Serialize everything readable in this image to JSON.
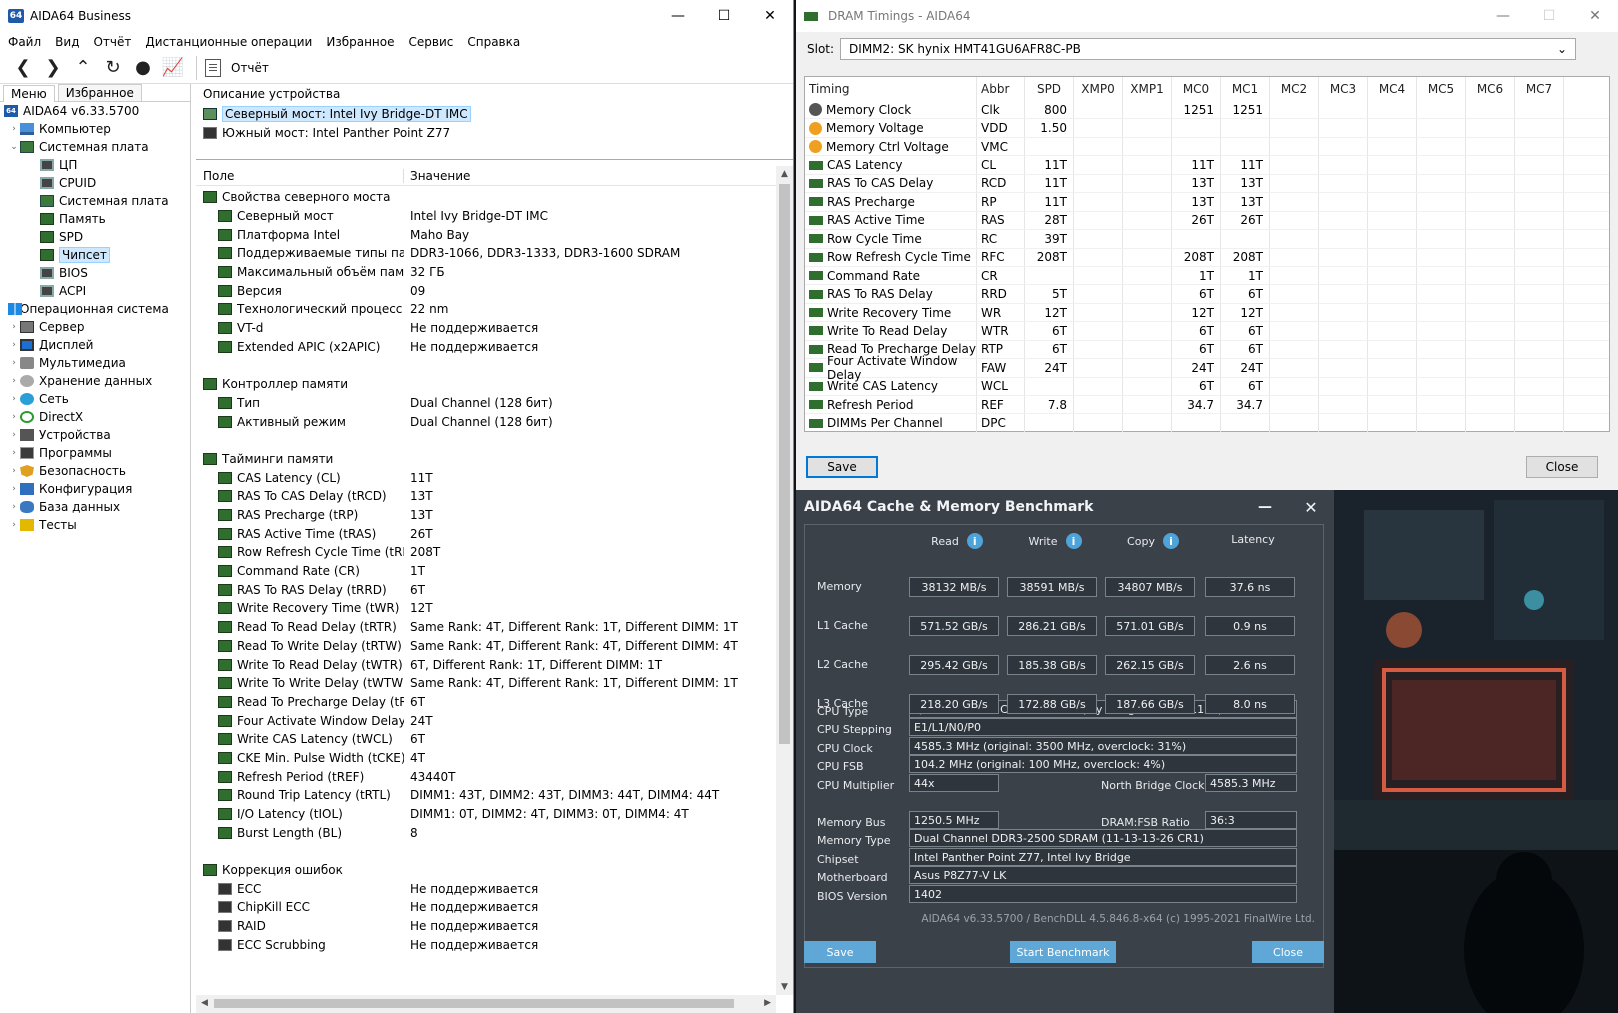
{
  "aida": {
    "title": "AIDA64 Business",
    "icon_text": "64",
    "menu": [
      "Файл",
      "Вид",
      "Отчёт",
      "Дистанционные операции",
      "Избранное",
      "Сервис",
      "Справка"
    ],
    "report_label": "Отчёт",
    "tabs": [
      "Меню",
      "Избранное"
    ],
    "tree": [
      {
        "label": "AIDA64 v6.33.5700",
        "icon": "aida-icon",
        "level": 0,
        "tw": ""
      },
      {
        "label": "Компьютер",
        "icon": "computer-icon",
        "level": 1,
        "tw": "›"
      },
      {
        "label": "Системная плата",
        "icon": "motherboard-icon",
        "level": 1,
        "tw": "⌄"
      },
      {
        "label": "ЦП",
        "icon": "cpu-icon",
        "level": 2,
        "tw": ""
      },
      {
        "label": "CPUID",
        "icon": "cpuid-icon",
        "level": 2,
        "tw": ""
      },
      {
        "label": "Системная плата",
        "icon": "board-icon",
        "level": 2,
        "tw": ""
      },
      {
        "label": "Память",
        "icon": "memory-icon",
        "level": 2,
        "tw": ""
      },
      {
        "label": "SPD",
        "icon": "spd-icon",
        "level": 2,
        "tw": ""
      },
      {
        "label": "Чипсет",
        "icon": "chipset-icon",
        "level": 2,
        "tw": "",
        "selected": true
      },
      {
        "label": "BIOS",
        "icon": "bios-icon",
        "level": 2,
        "tw": ""
      },
      {
        "label": "ACPI",
        "icon": "acpi-icon",
        "level": 2,
        "tw": ""
      },
      {
        "label": "Операционная система",
        "icon": "windows-icon",
        "level": 1,
        "tw": "›"
      },
      {
        "label": "Сервер",
        "icon": "server-icon",
        "level": 1,
        "tw": "›"
      },
      {
        "label": "Дисплей",
        "icon": "display-icon",
        "level": 1,
        "tw": "›"
      },
      {
        "label": "Мультимедиа",
        "icon": "multimedia-icon",
        "level": 1,
        "tw": "›"
      },
      {
        "label": "Хранение данных",
        "icon": "storage-icon",
        "level": 1,
        "tw": "›"
      },
      {
        "label": "Сеть",
        "icon": "network-icon",
        "level": 1,
        "tw": "›"
      },
      {
        "label": "DirectX",
        "icon": "directx-icon",
        "level": 1,
        "tw": "›"
      },
      {
        "label": "Устройства",
        "icon": "devices-icon",
        "level": 1,
        "tw": "›"
      },
      {
        "label": "Программы",
        "icon": "programs-icon",
        "level": 1,
        "tw": "›"
      },
      {
        "label": "Безопасность",
        "icon": "security-icon",
        "level": 1,
        "tw": "›"
      },
      {
        "label": "Конфигурация",
        "icon": "config-icon",
        "level": 1,
        "tw": "›"
      },
      {
        "label": "База данных",
        "icon": "database-icon",
        "level": 1,
        "tw": "›"
      },
      {
        "label": "Тесты",
        "icon": "tests-icon",
        "level": 1,
        "tw": "›"
      }
    ],
    "device_header": "Описание устройства",
    "devices": [
      "Северный мост: Intel Ivy Bridge-DT IMC",
      "Южный мост: Intel Panther Point Z77"
    ],
    "col_field": "Поле",
    "col_value": "Значение",
    "rows": [
      {
        "t": "g",
        "f": "Свойства северного моста",
        "v": ""
      },
      {
        "t": "s",
        "f": "Северный мост",
        "v": "Intel Ivy Bridge-DT IMC"
      },
      {
        "t": "s",
        "f": "Платформа Intel",
        "v": "Maho Bay"
      },
      {
        "t": "s",
        "f": "Поддерживаемые типы памя...",
        "v": "DDR3-1066, DDR3-1333, DDR3-1600 SDRAM"
      },
      {
        "t": "s",
        "f": "Максимальный объём памяти",
        "v": "32 ГБ"
      },
      {
        "t": "s",
        "f": "Версия",
        "v": "09"
      },
      {
        "t": "s",
        "f": "Технологический процесс",
        "v": "22 nm"
      },
      {
        "t": "s",
        "f": "VT-d",
        "v": "Не поддерживается"
      },
      {
        "t": "s",
        "f": "Extended APIC (x2APIC)",
        "v": "Не поддерживается"
      },
      {
        "t": "e",
        "f": "",
        "v": ""
      },
      {
        "t": "g",
        "f": "Контроллер памяти",
        "v": ""
      },
      {
        "t": "s",
        "f": "Тип",
        "v": "Dual Channel  (128 бит)"
      },
      {
        "t": "s",
        "f": "Активный режим",
        "v": "Dual Channel  (128 бит)"
      },
      {
        "t": "e",
        "f": "",
        "v": ""
      },
      {
        "t": "g",
        "f": "Тайминги памяти",
        "v": ""
      },
      {
        "t": "s",
        "f": "CAS Latency (CL)",
        "v": "11T"
      },
      {
        "t": "s",
        "f": "RAS To CAS Delay (tRCD)",
        "v": "13T"
      },
      {
        "t": "s",
        "f": "RAS Precharge (tRP)",
        "v": "13T"
      },
      {
        "t": "s",
        "f": "RAS Active Time (tRAS)",
        "v": "26T"
      },
      {
        "t": "s",
        "f": "Row Refresh Cycle Time (tRFC)",
        "v": "208T"
      },
      {
        "t": "s",
        "f": "Command Rate (CR)",
        "v": "1T"
      },
      {
        "t": "s",
        "f": "RAS To RAS Delay (tRRD)",
        "v": "6T"
      },
      {
        "t": "s",
        "f": "Write Recovery Time (tWR)",
        "v": "12T"
      },
      {
        "t": "s",
        "f": "Read To Read Delay (tRTR)",
        "v": "Same Rank: 4T, Different Rank: 1T, Different DIMM: 1T"
      },
      {
        "t": "s",
        "f": "Read To Write Delay (tRTW)",
        "v": "Same Rank: 4T, Different Rank: 4T, Different DIMM: 4T"
      },
      {
        "t": "s",
        "f": "Write To Read Delay (tWTR)",
        "v": "6T, Different Rank: 1T, Different DIMM: 1T"
      },
      {
        "t": "s",
        "f": "Write To Write Delay (tWTW)",
        "v": "Same Rank: 4T, Different Rank: 1T, Different DIMM: 1T"
      },
      {
        "t": "s",
        "f": "Read To Precharge Delay (tRTP)",
        "v": "6T"
      },
      {
        "t": "s",
        "f": "Four Activate Window Delay (t...",
        "v": "24T"
      },
      {
        "t": "s",
        "f": "Write CAS Latency (tWCL)",
        "v": "6T"
      },
      {
        "t": "s",
        "f": "CKE Min. Pulse Width (tCKE)",
        "v": "4T"
      },
      {
        "t": "s",
        "f": "Refresh Period (tREF)",
        "v": "43440T"
      },
      {
        "t": "s",
        "f": "Round Trip Latency (tRTL)",
        "v": "DIMM1: 43T, DIMM2: 43T, DIMM3: 44T, DIMM4: 44T"
      },
      {
        "t": "s",
        "f": "I/O Latency (tIOL)",
        "v": "DIMM1: 0T, DIMM2: 4T, DIMM3: 0T, DIMM4: 4T"
      },
      {
        "t": "s",
        "f": "Burst Length (BL)",
        "v": "8"
      },
      {
        "t": "e",
        "f": "",
        "v": ""
      },
      {
        "t": "g",
        "f": "Коррекция ошибок",
        "v": ""
      },
      {
        "t": "s",
        "f": "ECC",
        "v": "Не поддерживается"
      },
      {
        "t": "s",
        "f": "ChipKill ECC",
        "v": "Не поддерживается"
      },
      {
        "t": "s",
        "f": "RAID",
        "v": "Не поддерживается"
      },
      {
        "t": "s",
        "f": "ECC Scrubbing",
        "v": "Не поддерживается"
      }
    ]
  },
  "dram": {
    "title": "DRAM Timings - AIDA64",
    "slot_label": "Slot:",
    "slot_value": "DIMM2: SK hynix HMT41GU6AFR8C-PB",
    "columns": [
      "Timing",
      "Abbr",
      "SPD",
      "XMP0",
      "XMP1",
      "MC0",
      "MC1",
      "MC2",
      "MC3",
      "MC4",
      "MC5",
      "MC6",
      "MC7"
    ],
    "rows": [
      {
        "icon": "clock",
        "n": "Memory Clock",
        "a": "Clk",
        "v": [
          "800",
          "",
          "",
          "1251",
          "1251",
          "",
          "",
          "",
          "",
          "",
          ""
        ]
      },
      {
        "icon": "voltage",
        "n": "Memory Voltage",
        "a": "VDD",
        "v": [
          "1.50",
          "",
          "",
          "",
          "",
          "",
          "",
          "",
          "",
          "",
          ""
        ]
      },
      {
        "icon": "voltage",
        "n": "Memory Ctrl Voltage",
        "a": "VMC",
        "v": [
          "",
          "",
          "",
          "",
          "",
          "",
          "",
          "",
          "",
          "",
          ""
        ]
      },
      {
        "icon": "dram",
        "n": "CAS Latency",
        "a": "CL",
        "v": [
          "11T",
          "",
          "",
          "11T",
          "11T",
          "",
          "",
          "",
          "",
          "",
          ""
        ]
      },
      {
        "icon": "dram",
        "n": "RAS To CAS Delay",
        "a": "RCD",
        "v": [
          "11T",
          "",
          "",
          "13T",
          "13T",
          "",
          "",
          "",
          "",
          "",
          ""
        ]
      },
      {
        "icon": "dram",
        "n": "RAS Precharge",
        "a": "RP",
        "v": [
          "11T",
          "",
          "",
          "13T",
          "13T",
          "",
          "",
          "",
          "",
          "",
          ""
        ]
      },
      {
        "icon": "dram",
        "n": "RAS Active Time",
        "a": "RAS",
        "v": [
          "28T",
          "",
          "",
          "26T",
          "26T",
          "",
          "",
          "",
          "",
          "",
          ""
        ]
      },
      {
        "icon": "dram",
        "n": "Row Cycle Time",
        "a": "RC",
        "v": [
          "39T",
          "",
          "",
          "",
          "",
          "",
          "",
          "",
          "",
          "",
          ""
        ]
      },
      {
        "icon": "dram",
        "n": "Row Refresh Cycle Time",
        "a": "RFC",
        "v": [
          "208T",
          "",
          "",
          "208T",
          "208T",
          "",
          "",
          "",
          "",
          "",
          ""
        ]
      },
      {
        "icon": "dram",
        "n": "Command Rate",
        "a": "CR",
        "v": [
          "",
          "",
          "",
          "1T",
          "1T",
          "",
          "",
          "",
          "",
          "",
          ""
        ]
      },
      {
        "icon": "dram",
        "n": "RAS To RAS Delay",
        "a": "RRD",
        "v": [
          "5T",
          "",
          "",
          "6T",
          "6T",
          "",
          "",
          "",
          "",
          "",
          ""
        ]
      },
      {
        "icon": "dram",
        "n": "Write Recovery Time",
        "a": "WR",
        "v": [
          "12T",
          "",
          "",
          "12T",
          "12T",
          "",
          "",
          "",
          "",
          "",
          ""
        ]
      },
      {
        "icon": "dram",
        "n": "Write To Read Delay",
        "a": "WTR",
        "v": [
          "6T",
          "",
          "",
          "6T",
          "6T",
          "",
          "",
          "",
          "",
          "",
          ""
        ]
      },
      {
        "icon": "dram",
        "n": "Read To Precharge Delay",
        "a": "RTP",
        "v": [
          "6T",
          "",
          "",
          "6T",
          "6T",
          "",
          "",
          "",
          "",
          "",
          ""
        ]
      },
      {
        "icon": "dram",
        "n": "Four Activate Window Delay",
        "a": "FAW",
        "v": [
          "24T",
          "",
          "",
          "24T",
          "24T",
          "",
          "",
          "",
          "",
          "",
          ""
        ]
      },
      {
        "icon": "dram",
        "n": "Write CAS Latency",
        "a": "WCL",
        "v": [
          "",
          "",
          "",
          "6T",
          "6T",
          "",
          "",
          "",
          "",
          "",
          ""
        ]
      },
      {
        "icon": "dram",
        "n": "Refresh Period",
        "a": "REF",
        "v": [
          "7.8",
          "",
          "",
          "34.7",
          "34.7",
          "",
          "",
          "",
          "",
          "",
          ""
        ]
      },
      {
        "icon": "dram",
        "n": "DIMMs Per Channel",
        "a": "DPC",
        "v": [
          "",
          "",
          "",
          "",
          "",
          "",
          "",
          "",
          "",
          "",
          ""
        ]
      }
    ],
    "save": "Save",
    "close": "Close"
  },
  "bench": {
    "title": "AIDA64 Cache & Memory Benchmark",
    "headers": [
      "Read",
      "Write",
      "Copy",
      "Latency"
    ],
    "rows": [
      {
        "label": "Memory",
        "v": [
          "38132 MB/s",
          "38591 MB/s",
          "34807 MB/s",
          "37.6 ns"
        ]
      },
      {
        "label": "L1 Cache",
        "v": [
          "571.52 GB/s",
          "286.21 GB/s",
          "571.01 GB/s",
          "0.9 ns"
        ]
      },
      {
        "label": "L2 Cache",
        "v": [
          "295.42 GB/s",
          "185.38 GB/s",
          "262.15 GB/s",
          "2.6 ns"
        ]
      },
      {
        "label": "L3 Cache",
        "v": [
          "218.20 GB/s",
          "172.88 GB/s",
          "187.66 GB/s",
          "8.0 ns"
        ]
      }
    ],
    "cpu_type_label": "CPU Type",
    "cpu_type": "QuadCore Intel Core i7-3770K  (Ivy Bridge-DT, LGA1155)",
    "cpu_stepping_label": "CPU Stepping",
    "cpu_stepping": "E1/L1/N0/P0",
    "cpu_clock_label": "CPU Clock",
    "cpu_clock": "4585.3 MHz  (original: 3500 MHz, overclock: 31%)",
    "cpu_fsb_label": "CPU FSB",
    "cpu_fsb": "104.2 MHz  (original: 100 MHz, overclock: 4%)",
    "cpu_mult_label": "CPU Multiplier",
    "cpu_mult": "44x",
    "nb_clock_label": "North Bridge Clock",
    "nb_clock": "4585.3 MHz",
    "mem_bus_label": "Memory Bus",
    "mem_bus": "1250.5 MHz",
    "ratio_label": "DRAM:FSB Ratio",
    "ratio": "36:3",
    "mem_type_label": "Memory Type",
    "mem_type": "Dual Channel DDR3-2500 SDRAM  (11-13-13-26 CR1)",
    "chipset_label": "Chipset",
    "chipset": "Intel Panther Point Z77, Intel Ivy Bridge",
    "mobo_label": "Motherboard",
    "mobo": "Asus P8Z77-V LK",
    "bios_label": "BIOS Version",
    "bios": "1402",
    "footer": "AIDA64 v6.33.5700 / BenchDLL 4.5.846.8-x64  (c) 1995-2021 FinalWire Ltd.",
    "save": "Save",
    "start": "Start Benchmark",
    "close": "Close"
  }
}
